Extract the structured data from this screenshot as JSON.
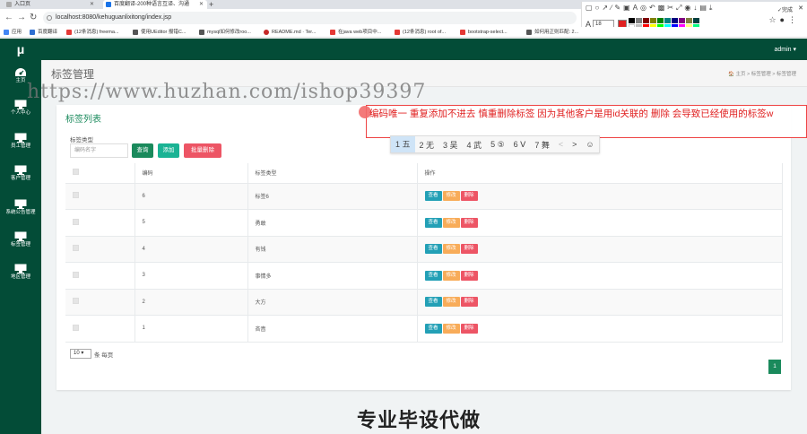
{
  "browser": {
    "tabs": [
      {
        "title": "入口页"
      },
      {
        "title": "百度翻译-200种语言互译、沟通"
      }
    ],
    "new_tab": "+",
    "url": "localhost:8080/kehuguanlixitong/index.jsp",
    "bookmarks": [
      {
        "label": "应用",
        "color": "#4285f4"
      },
      {
        "label": "百度翻译",
        "color": "#2f6fd1"
      },
      {
        "label": "(12条消息) freema...",
        "color": "#e53935"
      },
      {
        "label": "使用UEditor 报错C...",
        "color": "#555555"
      },
      {
        "label": "mysql如何修改roo...",
        "color": "#555555"
      },
      {
        "label": "README.md · Ter...",
        "color": "#c62828"
      },
      {
        "label": "在java web项目中...",
        "color": "#e53935"
      },
      {
        "label": "(12条消息) root of...",
        "color": "#e53935"
      },
      {
        "label": "bootstrap-select...",
        "color": "#e53935"
      },
      {
        "label": "如何用正则匹配: 2...",
        "color": "#555555"
      }
    ]
  },
  "annotation_toolbar": {
    "font_label": "A",
    "font_size": "18",
    "done_label": "完成",
    "current_color": "#e02020"
  },
  "app": {
    "logo": "μ",
    "user": "admin ▾",
    "sidebar": [
      {
        "label": "主页"
      },
      {
        "label": "个人中心"
      },
      {
        "label": "员工管理"
      },
      {
        "label": "客户管理"
      },
      {
        "label": "系统公告管理"
      },
      {
        "label": "标签管理"
      },
      {
        "label": "地区管理"
      }
    ],
    "page_title": "标签管理",
    "breadcrumb": "🏠 主页 > 标签管理 > 标签管理"
  },
  "panel": {
    "title": "标签列表",
    "filter_label": "标签类型",
    "search_placeholder": "编码名字",
    "query_button": "查询",
    "add_button": "添加",
    "batch_delete_button": "批量删除",
    "columns": [
      "",
      "编码",
      "标签类型",
      "操作"
    ],
    "rows": [
      {
        "code": "6",
        "type": "标签6"
      },
      {
        "code": "5",
        "type": "勇敢"
      },
      {
        "code": "4",
        "type": "有钱"
      },
      {
        "code": "3",
        "type": "事情多"
      },
      {
        "code": "2",
        "type": "大方"
      },
      {
        "code": "1",
        "type": "吝啬"
      }
    ],
    "actions": {
      "view": "查看",
      "edit": "修改",
      "delete": "删除"
    },
    "page_size": "10 ▾",
    "page_size_suffix": "条 每页",
    "current_page": "1"
  },
  "overlay": {
    "watermark": "https://www.huzhan.com/ishop39397",
    "note": "编码唯一  重复添加不进去  慎重删除标签  因为其他客户是用id关联的  删除 会导致已经使用的标签w",
    "ime_candidates": [
      "1 五",
      "2 无",
      "3 吴",
      "4 武",
      "5 ⑤",
      "6 Ⅴ",
      "7 舞",
      "<",
      ">",
      "☺"
    ],
    "bottom_watermark": "专业毕设代做"
  }
}
